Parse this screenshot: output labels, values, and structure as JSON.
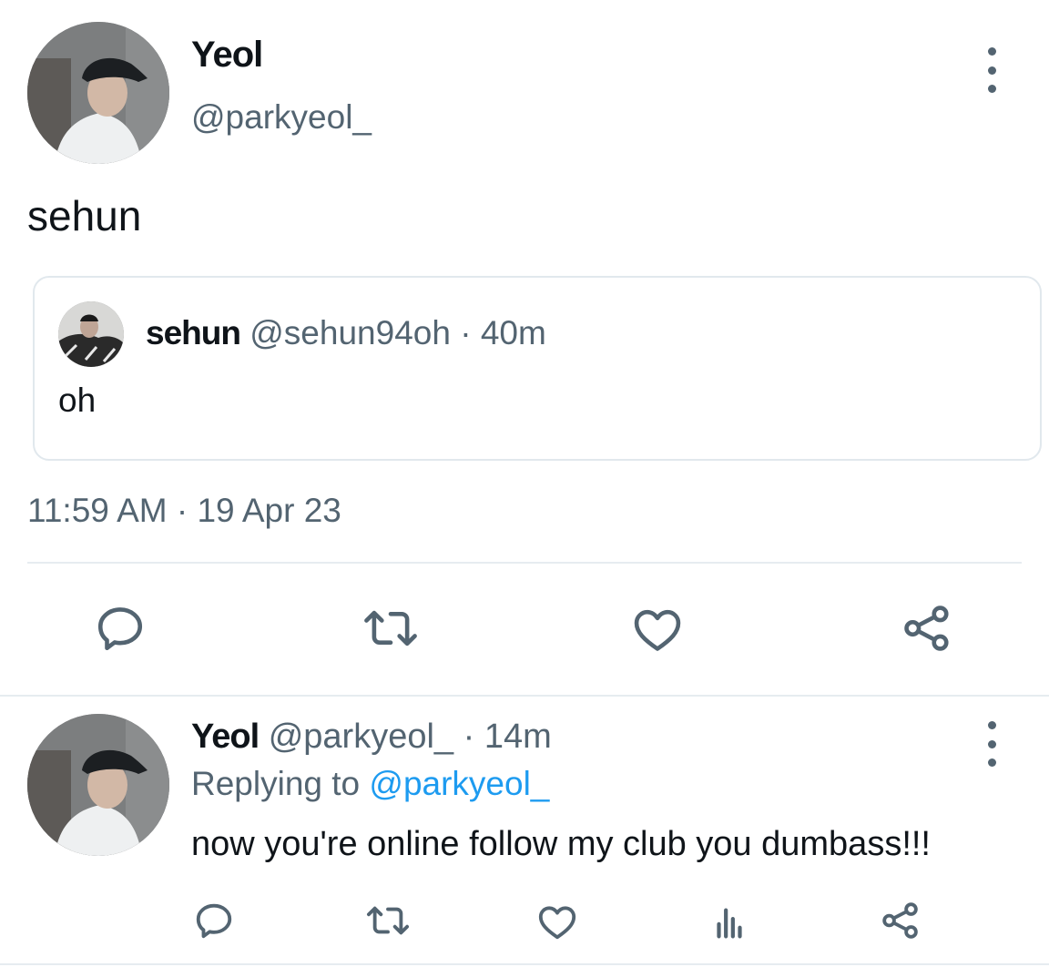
{
  "main_tweet": {
    "display_name": "Yeol",
    "handle": "@parkyeol_",
    "text": "sehun",
    "timestamp": "11:59 AM · 19 Apr 23",
    "quoted": {
      "display_name": "sehun",
      "handle": "@sehun94oh",
      "time": "· 40m",
      "text": "oh"
    },
    "actions": [
      "reply-icon",
      "retweet-icon",
      "like-icon",
      "share-icon"
    ]
  },
  "reply_tweet": {
    "display_name": "Yeol",
    "handle": "@parkyeol_",
    "time": "· 14m",
    "replying_prefix": "Replying to",
    "replying_handle": "@parkyeol_",
    "text": "now you're online follow my club you dumbass!!!",
    "actions": [
      "reply-icon",
      "retweet-icon",
      "like-icon",
      "analytics-icon",
      "share-icon"
    ]
  },
  "colors": {
    "text": "#0f1419",
    "muted": "#536471",
    "link": "#1d9bf0",
    "border": "#e1e8ed"
  }
}
